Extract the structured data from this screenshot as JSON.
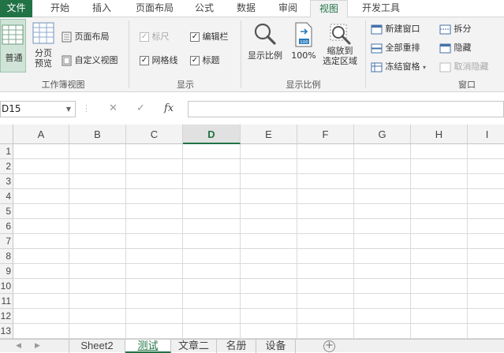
{
  "tabs": [
    "文件",
    "开始",
    "插入",
    "页面布局",
    "公式",
    "数据",
    "审阅",
    "视图",
    "开发工具"
  ],
  "ribbon": {
    "workbook_views": {
      "normal": "普通",
      "page_break": [
        "分页",
        "预览"
      ],
      "page_layout": "页面布局",
      "custom_views": "自定义视图",
      "label": "工作簿视图"
    },
    "show": {
      "ruler": "标尺",
      "formula_bar": "编辑栏",
      "gridlines": "网格线",
      "headings": "标题",
      "label": "显示",
      "ruler_checked": true,
      "formula_bar_checked": true,
      "gridlines_checked": true,
      "headings_checked": true
    },
    "zoom": {
      "zoom": "显示比例",
      "hundred": "100%",
      "zoom_selection": [
        "缩放到",
        "选定区域"
      ],
      "label": "显示比例"
    },
    "window": {
      "new_window": "新建窗口",
      "arrange_all": "全部重排",
      "freeze_panes": "冻结窗格",
      "split": "拆分",
      "hide": "隐藏",
      "unhide": "取消隐藏",
      "label": "窗口"
    }
  },
  "formula_bar": {
    "name_box": "D15",
    "cancel": "✕",
    "enter": "✓",
    "fx": "fx",
    "value": ""
  },
  "grid": {
    "columns": [
      "A",
      "B",
      "C",
      "D",
      "E",
      "F",
      "G",
      "H",
      "I"
    ],
    "selected_column": "D",
    "rows": [
      "1",
      "2",
      "3",
      "4",
      "5",
      "6",
      "7",
      "8",
      "9",
      "10",
      "11",
      "12",
      "13"
    ]
  },
  "sheets": {
    "tabs": [
      "Sheet2",
      "测试",
      "文章二",
      "名册",
      "设备"
    ],
    "active": "测试",
    "add": "+"
  },
  "colors": {
    "accent": "#217346",
    "ribbon_bg": "#f3f3f3",
    "header_bg": "#f3f3f3"
  }
}
